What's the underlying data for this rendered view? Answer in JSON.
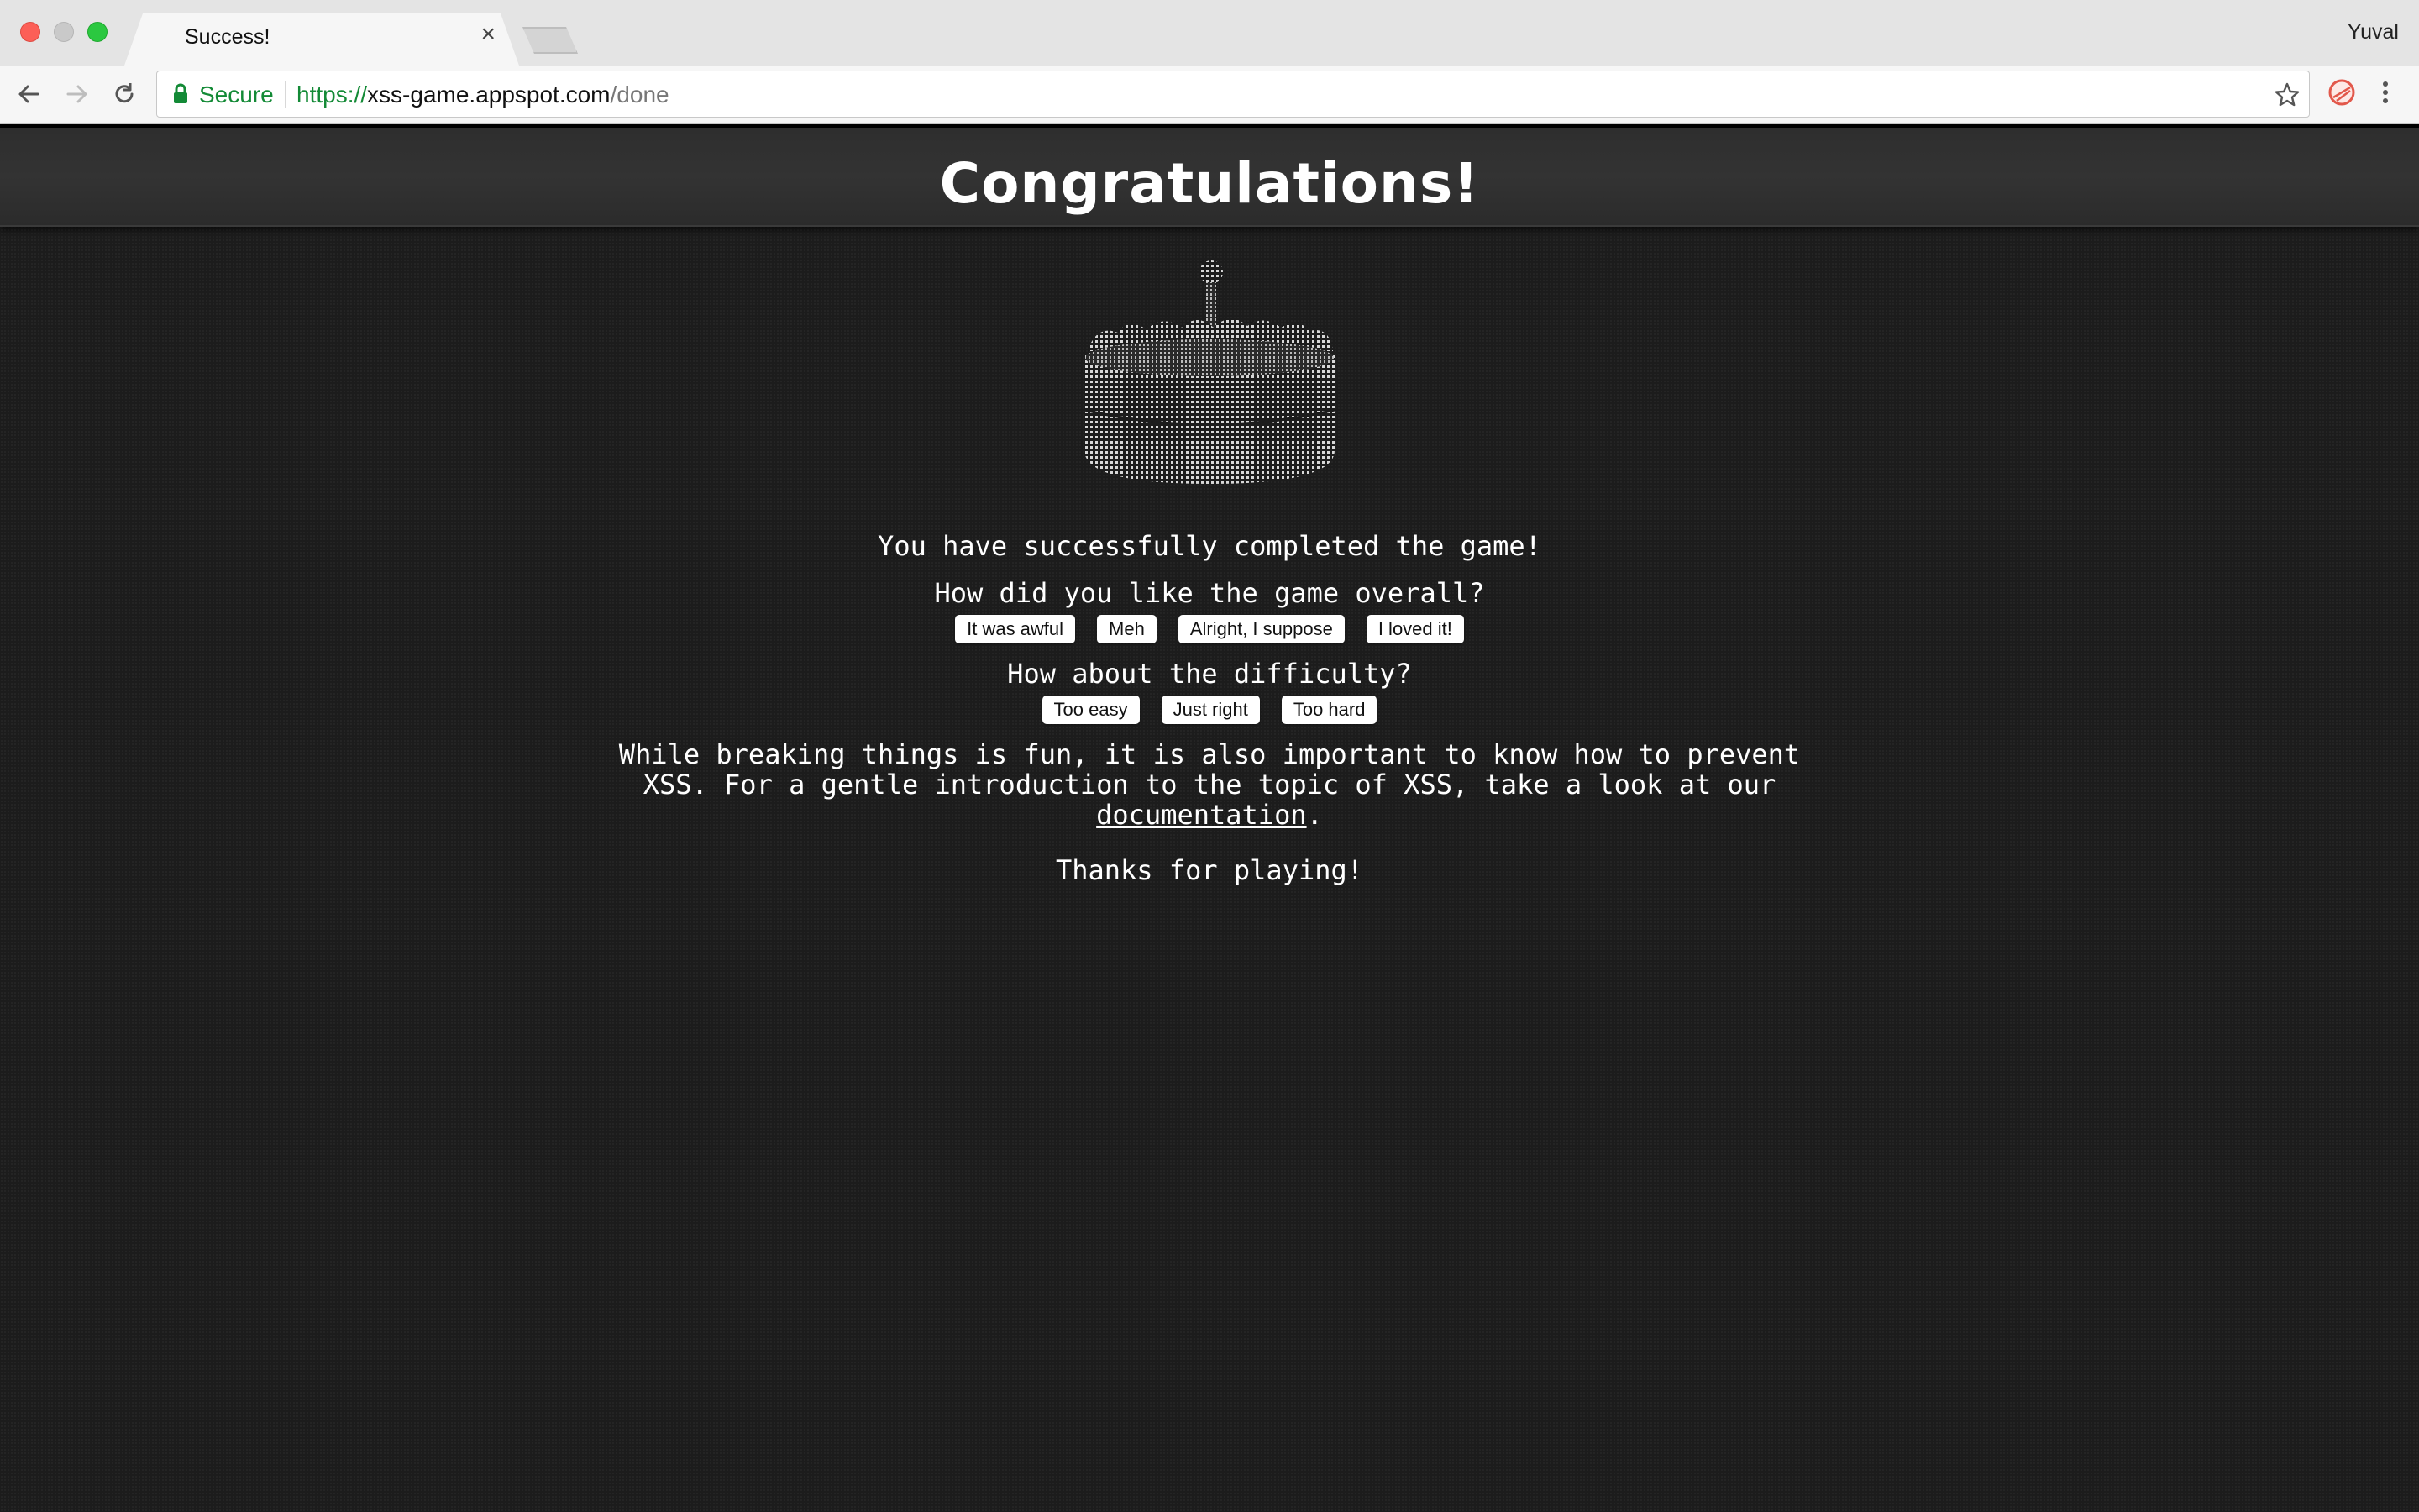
{
  "browser": {
    "tab_title": "Success!",
    "tab_close": "×",
    "profile_name": "Yuval",
    "secure_label": "Secure",
    "url_scheme": "https://",
    "url_host": "xss-game.appspot.com",
    "url_path": "/done"
  },
  "page": {
    "heading": "Congratulations!",
    "completed_text": "You have successfully completed the game!",
    "overall_question": "How did you like the game overall?",
    "overall_options": [
      "It was awful",
      "Meh",
      "Alright, I suppose",
      "I loved it!"
    ],
    "difficulty_question": "How about the difficulty?",
    "difficulty_options": [
      "Too easy",
      "Just right",
      "Too hard"
    ],
    "paragraph_before_link": "While breaking things is fun, it is also important to know how to prevent XSS. For a gentle introduction to the topic of XSS, take a look at our ",
    "documentation_link": "documentation",
    "paragraph_after_link": ".",
    "thanks_text": "Thanks for playing!"
  },
  "colors": {
    "secure_green": "#138a36",
    "page_background": "#1c1c1c",
    "banner_background": "#2e2e2e"
  },
  "icons": [
    "back-arrow-icon",
    "forward-arrow-icon",
    "reload-icon",
    "lock-icon",
    "star-icon",
    "extension-icon",
    "menu-dots-icon",
    "cake-icon"
  ]
}
